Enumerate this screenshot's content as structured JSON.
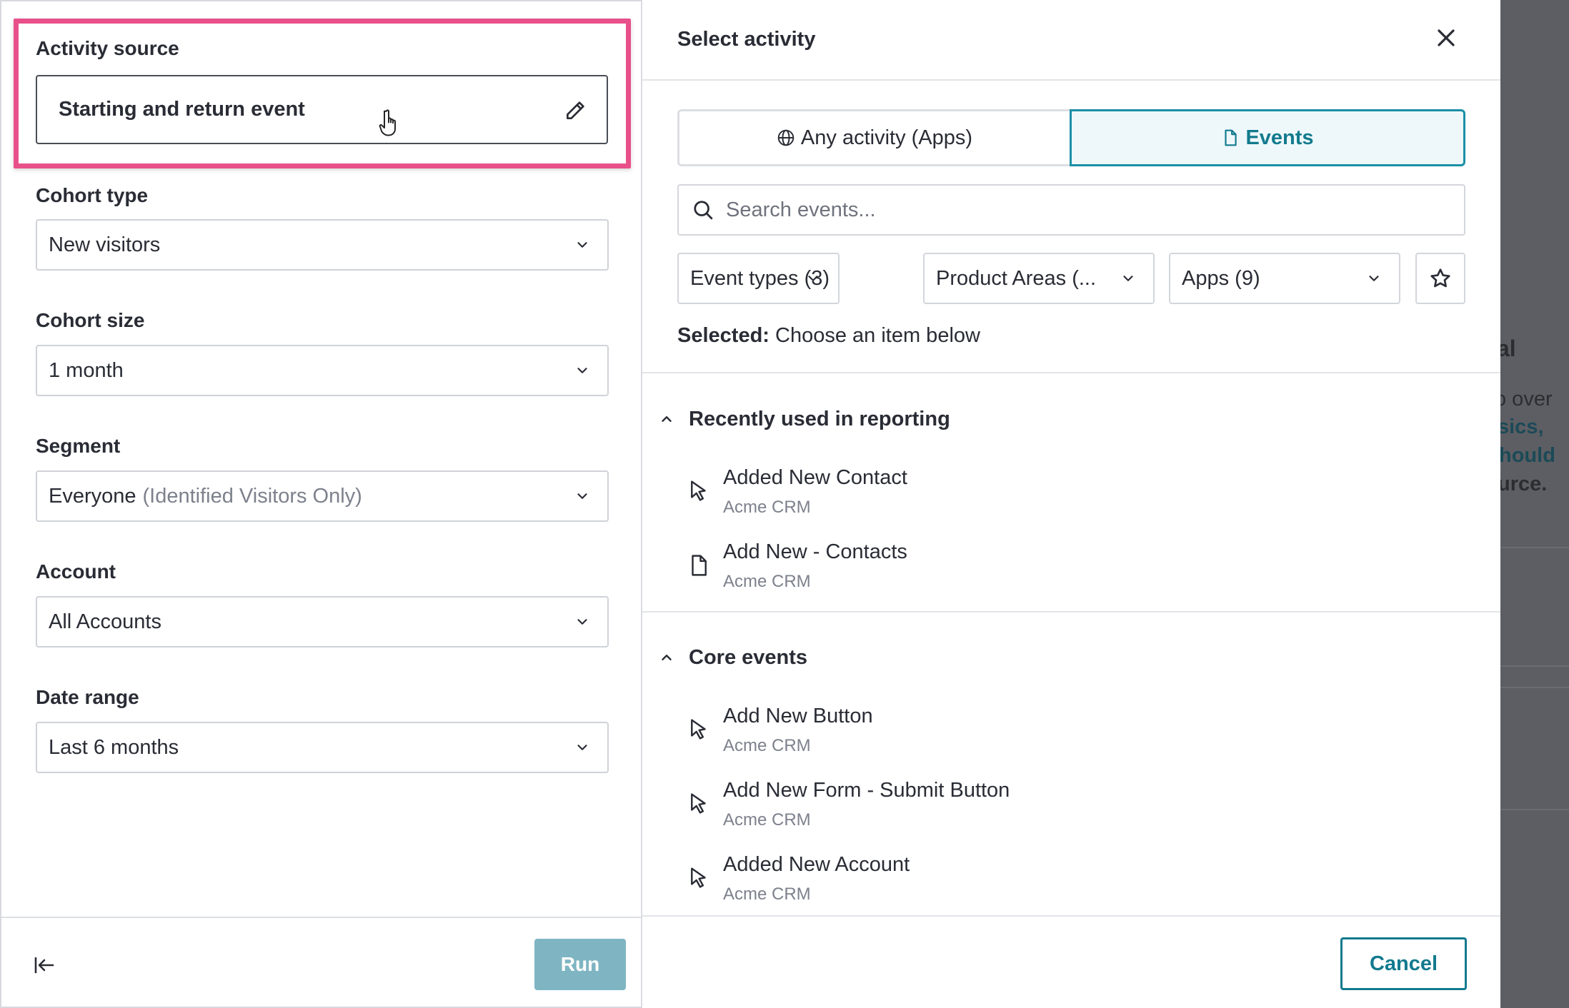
{
  "left_panel": {
    "activity_source": {
      "label": "Activity source",
      "value": "Starting and return event"
    },
    "cohort_type": {
      "label": "Cohort type",
      "value": "New visitors"
    },
    "cohort_size": {
      "label": "Cohort size",
      "value": "1 month"
    },
    "segment": {
      "label": "Segment",
      "value": "Everyone",
      "qualifier": "(Identified Visitors Only)"
    },
    "account": {
      "label": "Account",
      "value": "All Accounts"
    },
    "date_range": {
      "label": "Date range",
      "value": "Last 6 months"
    },
    "run_label": "Run"
  },
  "modal": {
    "title": "Select activity",
    "tabs": {
      "any": "Any activity (Apps)",
      "events": "Events"
    },
    "search": {
      "placeholder": "Search events..."
    },
    "filters": {
      "event_types": "Event types (3)",
      "product_areas": "Product Areas (...",
      "apps": "Apps (9)"
    },
    "selected": {
      "label": "Selected:",
      "value": "Choose an item below"
    },
    "sections": [
      {
        "title": "Recently used in reporting",
        "items": [
          {
            "name": "Added New Contact",
            "app": "Acme CRM",
            "icon": "cursor-icon"
          },
          {
            "name": "Add New - Contacts",
            "app": "Acme CRM",
            "icon": "page-icon"
          }
        ]
      },
      {
        "title": "Core events",
        "items": [
          {
            "name": "Add New Button",
            "app": "Acme CRM",
            "icon": "cursor-icon"
          },
          {
            "name": "Add New Form - Submit Button",
            "app": "Acme CRM",
            "icon": "cursor-icon"
          },
          {
            "name": "Added New Account",
            "app": "Acme CRM",
            "icon": "cursor-icon"
          }
        ]
      }
    ],
    "cancel_label": "Cancel"
  },
  "background": {
    "fragments": [
      "al",
      "o over",
      "sics,",
      "hould",
      "urce."
    ]
  },
  "colors": {
    "accent": "#127a8e",
    "highlight": "#e8508a",
    "run_button": "#7fb5c3",
    "overlay": "#5d5e63"
  }
}
